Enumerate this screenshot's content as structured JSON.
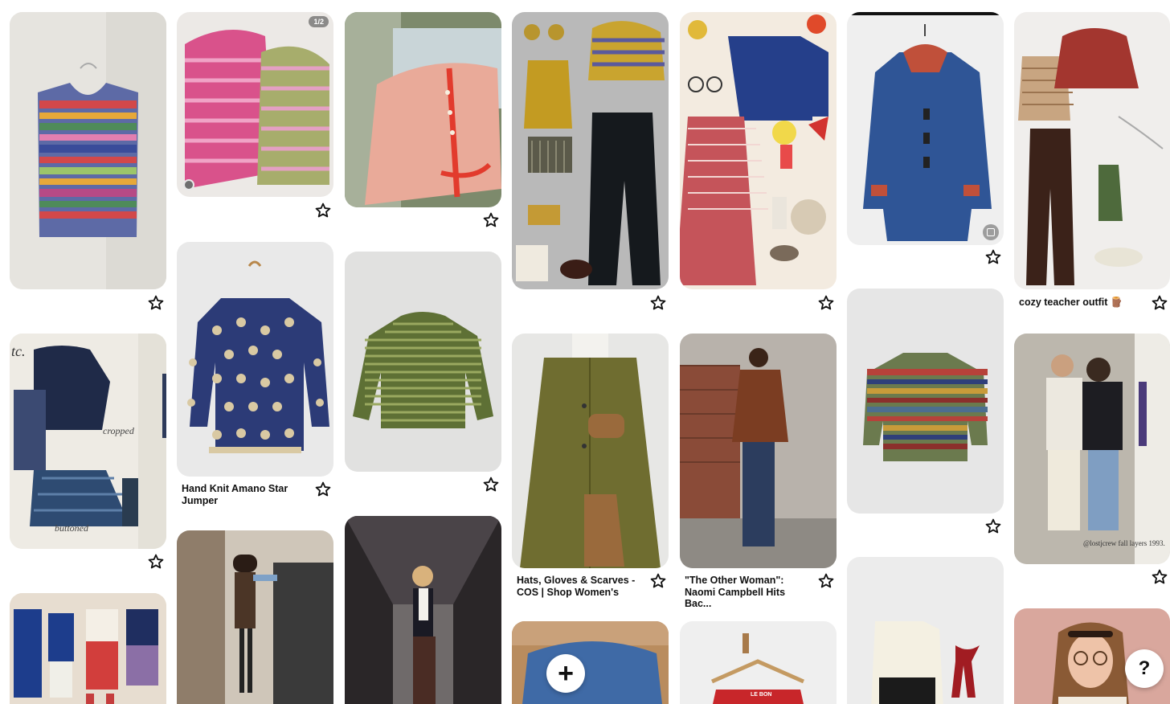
{
  "board": {
    "pins": [
      {
        "id": "striped-vest",
        "caption": ""
      },
      {
        "id": "pink-green-sweaters",
        "caption": "",
        "page_badge": "1/2"
      },
      {
        "id": "pink-cardigan",
        "caption": ""
      },
      {
        "id": "mustard-outfit-collage",
        "caption": ""
      },
      {
        "id": "chore-jacket-collage",
        "caption": ""
      },
      {
        "id": "denim-coat",
        "caption": ""
      },
      {
        "id": "cozy-teacher",
        "caption": "cozy teacher outfit 🪵"
      },
      {
        "id": "navy-catalog",
        "caption": "",
        "text_cropped": "cropped",
        "text_buttoned": "buttoned",
        "text_tc": "tc."
      },
      {
        "id": "star-jumper",
        "caption": "Hand Knit Amano Star\nJumper"
      },
      {
        "id": "green-stripe",
        "caption": ""
      },
      {
        "id": "olive-coat",
        "caption": "Hats, Gloves & Scarves -\nCOS | Shop Women's"
      },
      {
        "id": "other-woman",
        "caption": "\"The Other Woman\":\nNaomi Campbell Hits Bac..."
      },
      {
        "id": "multistripe-sweater",
        "caption": ""
      },
      {
        "id": "jcrew-catalog",
        "caption": "",
        "credit": "@lostjcrew  fall layers 1993."
      },
      {
        "id": "sixties-girls",
        "caption": ""
      },
      {
        "id": "brown-dress-street",
        "caption": ""
      },
      {
        "id": "tunnel-woman",
        "caption": ""
      },
      {
        "id": "blue-fuzzy",
        "caption": ""
      },
      {
        "id": "red-knit-hanger",
        "caption": "",
        "tag": "LE BON"
      },
      {
        "id": "cream-cardigan",
        "caption": ""
      },
      {
        "id": "glasses-woman",
        "caption": ""
      }
    ]
  },
  "controls": {
    "add_label": "+",
    "help_label": "?"
  },
  "icons": {
    "save": "star-outline-icon",
    "add": "plus-icon",
    "help": "question-icon"
  }
}
